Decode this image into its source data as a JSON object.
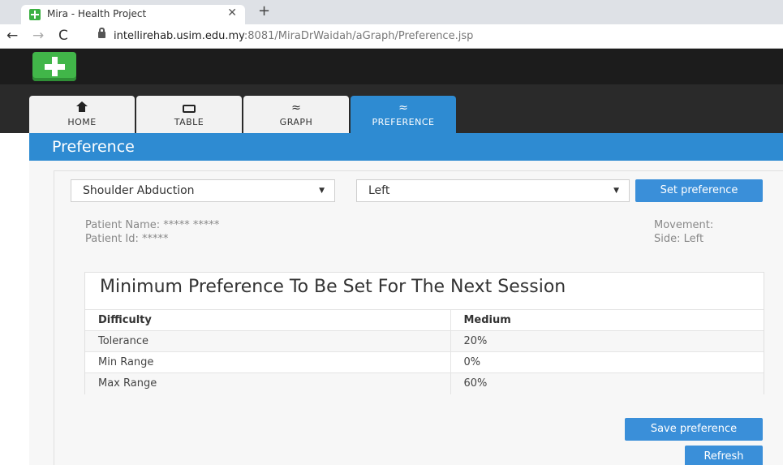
{
  "browser": {
    "tab_title": "Mira - Health Project",
    "tab_close": "✕",
    "new_tab": "+",
    "back": "←",
    "forward": "→",
    "reload": "C",
    "url_host": "intellirehab.usim.edu.my",
    "url_path": ":8081/MiraDrWaidah/aGraph/Preference.jsp"
  },
  "nav": {
    "tabs": [
      {
        "label": "HOME",
        "icon": "home-icon"
      },
      {
        "label": "TABLE",
        "icon": "keyboard-icon"
      },
      {
        "label": "GRAPH",
        "icon": "graph-icon",
        "glyph": "≈"
      },
      {
        "label": "PREFERENCE",
        "icon": "graph-icon",
        "glyph": "≈"
      }
    ],
    "active": "PREFERENCE"
  },
  "section": {
    "title": "Preference"
  },
  "controls": {
    "movement_value": "Shoulder Abduction",
    "side_value": "Left",
    "caret": "▼",
    "set_label": "Set preference"
  },
  "patient": {
    "name": "Patient Name: ***** *****",
    "id": "Patient Id: *****",
    "movement": "Movement:",
    "side": "Side: Left"
  },
  "preference": {
    "title": "Minimum Preference To Be Set For The Next Session",
    "rows": [
      {
        "label": "Difficulty",
        "value": "Medium"
      },
      {
        "label": "Tolerance",
        "value": "20%"
      },
      {
        "label": "Min Range",
        "value": "0%"
      },
      {
        "label": "Max Range",
        "value": "60%"
      }
    ]
  },
  "actions": {
    "save_label": "Save preference",
    "refresh_label": "Refresh"
  },
  "colors": {
    "accent": "#2e8bd2",
    "button": "#3a8fd9",
    "logo": "#41b649",
    "header": "#1c1c1c"
  }
}
